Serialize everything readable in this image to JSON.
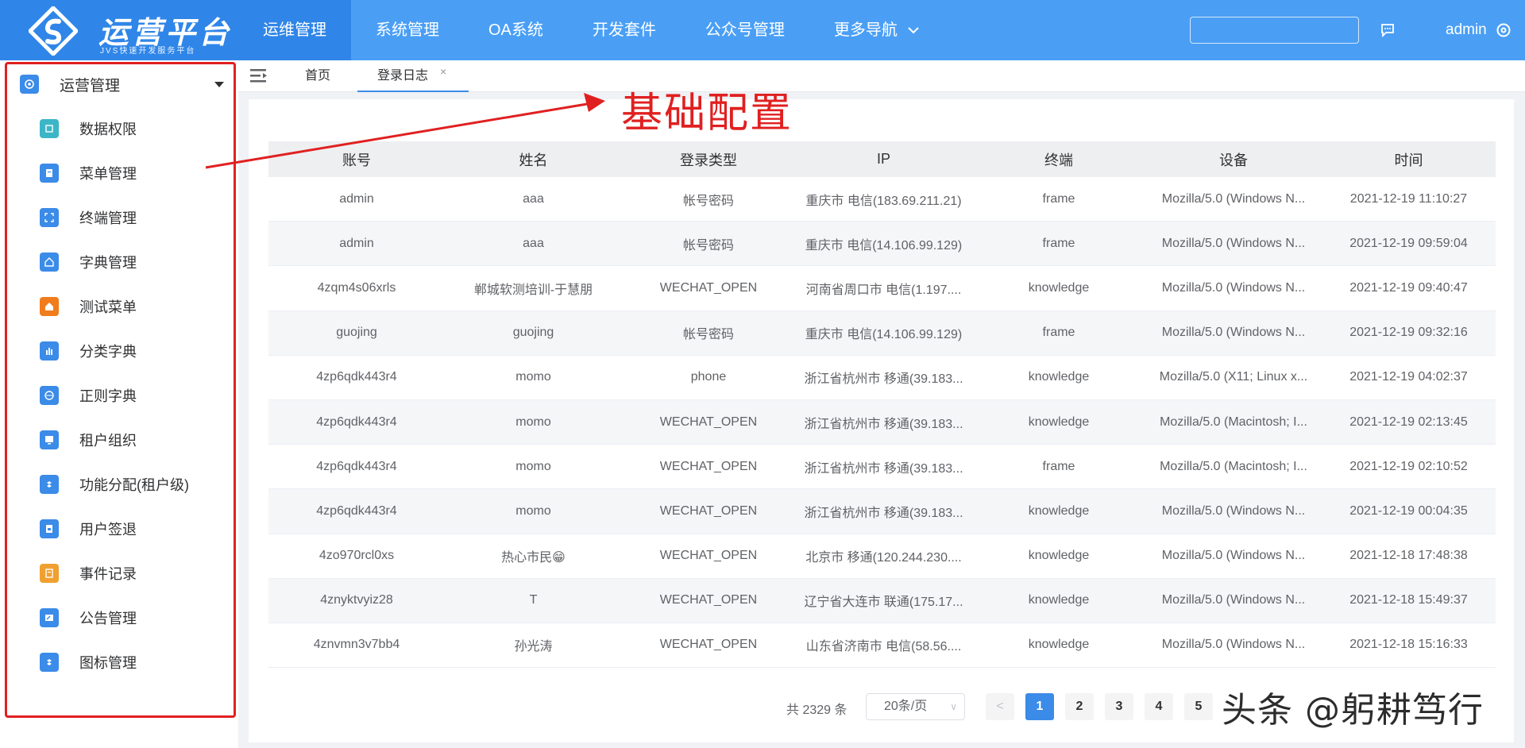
{
  "app": {
    "logo_title": "运营平台",
    "logo_subtitle": "JVS快速开发服务平台",
    "brand_color": "#4a9ff5",
    "active_color": "#2f86e8"
  },
  "topnav": {
    "items": [
      {
        "label": "运维管理",
        "active": true
      },
      {
        "label": "系统管理",
        "active": false
      },
      {
        "label": "OA系统",
        "active": false
      },
      {
        "label": "开发套件",
        "active": false
      },
      {
        "label": "公众号管理",
        "active": false
      },
      {
        "label": "更多导航",
        "active": false
      }
    ],
    "search_placeholder": "",
    "user": "admin"
  },
  "sidebar": {
    "group": "运营管理",
    "items": [
      {
        "label": "数据权限",
        "icon": "database-icon",
        "color": "#3cb6c6"
      },
      {
        "label": "菜单管理",
        "icon": "menu-doc-icon",
        "color": "#3b8be8"
      },
      {
        "label": "终端管理",
        "icon": "scan-icon",
        "color": "#3b8be8"
      },
      {
        "label": "字典管理",
        "icon": "home-icon",
        "color": "#3b8be8"
      },
      {
        "label": "测试菜单",
        "icon": "house-icon",
        "color": "#f07c1b"
      },
      {
        "label": "分类字典",
        "icon": "bar-chart-icon",
        "color": "#3b8be8"
      },
      {
        "label": "正则字典",
        "icon": "globe-icon",
        "color": "#3b8be8"
      },
      {
        "label": "租户组织",
        "icon": "org-icon",
        "color": "#3b8be8"
      },
      {
        "label": "功能分配(租户级)",
        "icon": "dropbox-icon",
        "color": "#3b8be8"
      },
      {
        "label": "用户签退",
        "icon": "logout-icon",
        "color": "#3b8be8"
      },
      {
        "label": "事件记录",
        "icon": "record-icon",
        "color": "#f0a030"
      },
      {
        "label": "公告管理",
        "icon": "notice-icon",
        "color": "#3b8be8"
      },
      {
        "label": "图标管理",
        "icon": "dropbox-icon",
        "color": "#3b8be8"
      }
    ]
  },
  "tabs": {
    "home": "首页",
    "login_log": "登录日志",
    "close": "×"
  },
  "annotation": {
    "text": "基础配置",
    "color": "#e02020"
  },
  "table": {
    "columns": [
      "账号",
      "姓名",
      "登录类型",
      "IP",
      "终端",
      "设备",
      "时间"
    ],
    "rows": [
      [
        "admin",
        "aaa",
        "帐号密码",
        "重庆市 电信(183.69.211.21)",
        "frame",
        "Mozilla/5.0 (Windows N...",
        "2021-12-19 11:10:27"
      ],
      [
        "admin",
        "aaa",
        "帐号密码",
        "重庆市 电信(14.106.99.129)",
        "frame",
        "Mozilla/5.0 (Windows N...",
        "2021-12-19 09:59:04"
      ],
      [
        "4zqm4s06xrls",
        "郸城软测培训-于慧朋",
        "WECHAT_OPEN",
        "河南省周口市 电信(1.197....",
        "knowledge",
        "Mozilla/5.0 (Windows N...",
        "2021-12-19 09:40:47"
      ],
      [
        "guojing",
        "guojing",
        "帐号密码",
        "重庆市 电信(14.106.99.129)",
        "frame",
        "Mozilla/5.0 (Windows N...",
        "2021-12-19 09:32:16"
      ],
      [
        "4zp6qdk443r4",
        "momo",
        "phone",
        "浙江省杭州市 移通(39.183...",
        "knowledge",
        "Mozilla/5.0 (X11; Linux x...",
        "2021-12-19 04:02:37"
      ],
      [
        "4zp6qdk443r4",
        "momo",
        "WECHAT_OPEN",
        "浙江省杭州市 移通(39.183...",
        "knowledge",
        "Mozilla/5.0 (Macintosh; I...",
        "2021-12-19 02:13:45"
      ],
      [
        "4zp6qdk443r4",
        "momo",
        "WECHAT_OPEN",
        "浙江省杭州市 移通(39.183...",
        "frame",
        "Mozilla/5.0 (Macintosh; I...",
        "2021-12-19 02:10:52"
      ],
      [
        "4zp6qdk443r4",
        "momo",
        "WECHAT_OPEN",
        "浙江省杭州市 移通(39.183...",
        "knowledge",
        "Mozilla/5.0 (Windows N...",
        "2021-12-19 00:04:35"
      ],
      [
        "4zo970rcl0xs",
        "热心市民😁",
        "WECHAT_OPEN",
        "北京市 移通(120.244.230....",
        "knowledge",
        "Mozilla/5.0 (Windows N...",
        "2021-12-18 17:48:38"
      ],
      [
        "4znyktvyiz28",
        "T",
        "WECHAT_OPEN",
        "辽宁省大连市 联通(175.17...",
        "knowledge",
        "Mozilla/5.0 (Windows N...",
        "2021-12-18 15:49:37"
      ],
      [
        "4znvmn3v7bb4",
        "孙光涛",
        "WECHAT_OPEN",
        "山东省济南市 电信(58.56....",
        "knowledge",
        "Mozilla/5.0 (Windows N...",
        "2021-12-18 15:16:33"
      ]
    ]
  },
  "pagination": {
    "total": "共 2329 条",
    "page_size": "20条/页",
    "pages": [
      "1",
      "2",
      "3",
      "4",
      "5"
    ],
    "current": 1
  },
  "watermark": "头条 @躬耕笃行"
}
